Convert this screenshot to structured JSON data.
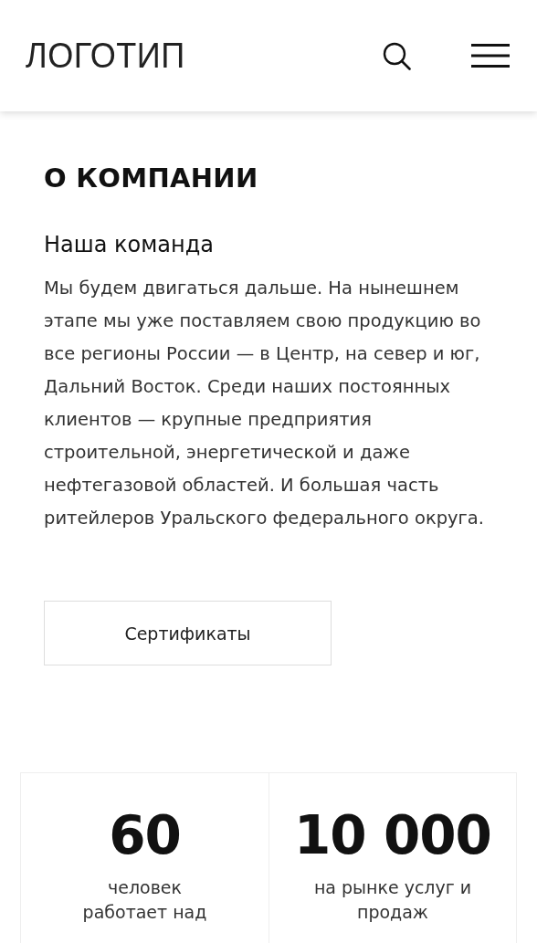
{
  "header": {
    "logo": "ЛОГОТИП"
  },
  "section": {
    "title": "О КОМПАНИИ",
    "subtitle": "Наша команда",
    "text": "Мы будем двигаться дальше. На нынешнем этапе мы уже поставляем свою продукцию во все регионы России — в Центр, на север и юг, Дальний Восток. Среди наших постоянных клиентов — крупные предприятия строительной, энергетической и даже нефтегазовой областей. И большая часть ритейлеров Уральского федерального округа.",
    "button": "Сертификаты"
  },
  "stats": [
    {
      "value": "60",
      "label": "человек работает над"
    },
    {
      "value": "10 000",
      "label": "на рынке услуг и продаж"
    }
  ]
}
